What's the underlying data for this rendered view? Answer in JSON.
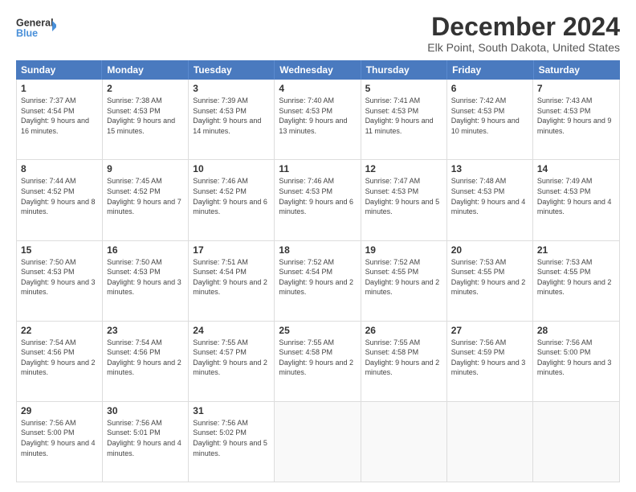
{
  "logo": {
    "line1": "General",
    "line2": "Blue"
  },
  "title": "December 2024",
  "subtitle": "Elk Point, South Dakota, United States",
  "header_days": [
    "Sunday",
    "Monday",
    "Tuesday",
    "Wednesday",
    "Thursday",
    "Friday",
    "Saturday"
  ],
  "weeks": [
    [
      {
        "day": "1",
        "sunrise": "Sunrise: 7:37 AM",
        "sunset": "Sunset: 4:54 PM",
        "daylight": "Daylight: 9 hours and 16 minutes."
      },
      {
        "day": "2",
        "sunrise": "Sunrise: 7:38 AM",
        "sunset": "Sunset: 4:53 PM",
        "daylight": "Daylight: 9 hours and 15 minutes."
      },
      {
        "day": "3",
        "sunrise": "Sunrise: 7:39 AM",
        "sunset": "Sunset: 4:53 PM",
        "daylight": "Daylight: 9 hours and 14 minutes."
      },
      {
        "day": "4",
        "sunrise": "Sunrise: 7:40 AM",
        "sunset": "Sunset: 4:53 PM",
        "daylight": "Daylight: 9 hours and 13 minutes."
      },
      {
        "day": "5",
        "sunrise": "Sunrise: 7:41 AM",
        "sunset": "Sunset: 4:53 PM",
        "daylight": "Daylight: 9 hours and 11 minutes."
      },
      {
        "day": "6",
        "sunrise": "Sunrise: 7:42 AM",
        "sunset": "Sunset: 4:53 PM",
        "daylight": "Daylight: 9 hours and 10 minutes."
      },
      {
        "day": "7",
        "sunrise": "Sunrise: 7:43 AM",
        "sunset": "Sunset: 4:53 PM",
        "daylight": "Daylight: 9 hours and 9 minutes."
      }
    ],
    [
      {
        "day": "8",
        "sunrise": "Sunrise: 7:44 AM",
        "sunset": "Sunset: 4:52 PM",
        "daylight": "Daylight: 9 hours and 8 minutes."
      },
      {
        "day": "9",
        "sunrise": "Sunrise: 7:45 AM",
        "sunset": "Sunset: 4:52 PM",
        "daylight": "Daylight: 9 hours and 7 minutes."
      },
      {
        "day": "10",
        "sunrise": "Sunrise: 7:46 AM",
        "sunset": "Sunset: 4:52 PM",
        "daylight": "Daylight: 9 hours and 6 minutes."
      },
      {
        "day": "11",
        "sunrise": "Sunrise: 7:46 AM",
        "sunset": "Sunset: 4:53 PM",
        "daylight": "Daylight: 9 hours and 6 minutes."
      },
      {
        "day": "12",
        "sunrise": "Sunrise: 7:47 AM",
        "sunset": "Sunset: 4:53 PM",
        "daylight": "Daylight: 9 hours and 5 minutes."
      },
      {
        "day": "13",
        "sunrise": "Sunrise: 7:48 AM",
        "sunset": "Sunset: 4:53 PM",
        "daylight": "Daylight: 9 hours and 4 minutes."
      },
      {
        "day": "14",
        "sunrise": "Sunrise: 7:49 AM",
        "sunset": "Sunset: 4:53 PM",
        "daylight": "Daylight: 9 hours and 4 minutes."
      }
    ],
    [
      {
        "day": "15",
        "sunrise": "Sunrise: 7:50 AM",
        "sunset": "Sunset: 4:53 PM",
        "daylight": "Daylight: 9 hours and 3 minutes."
      },
      {
        "day": "16",
        "sunrise": "Sunrise: 7:50 AM",
        "sunset": "Sunset: 4:53 PM",
        "daylight": "Daylight: 9 hours and 3 minutes."
      },
      {
        "day": "17",
        "sunrise": "Sunrise: 7:51 AM",
        "sunset": "Sunset: 4:54 PM",
        "daylight": "Daylight: 9 hours and 2 minutes."
      },
      {
        "day": "18",
        "sunrise": "Sunrise: 7:52 AM",
        "sunset": "Sunset: 4:54 PM",
        "daylight": "Daylight: 9 hours and 2 minutes."
      },
      {
        "day": "19",
        "sunrise": "Sunrise: 7:52 AM",
        "sunset": "Sunset: 4:55 PM",
        "daylight": "Daylight: 9 hours and 2 minutes."
      },
      {
        "day": "20",
        "sunrise": "Sunrise: 7:53 AM",
        "sunset": "Sunset: 4:55 PM",
        "daylight": "Daylight: 9 hours and 2 minutes."
      },
      {
        "day": "21",
        "sunrise": "Sunrise: 7:53 AM",
        "sunset": "Sunset: 4:55 PM",
        "daylight": "Daylight: 9 hours and 2 minutes."
      }
    ],
    [
      {
        "day": "22",
        "sunrise": "Sunrise: 7:54 AM",
        "sunset": "Sunset: 4:56 PM",
        "daylight": "Daylight: 9 hours and 2 minutes."
      },
      {
        "day": "23",
        "sunrise": "Sunrise: 7:54 AM",
        "sunset": "Sunset: 4:56 PM",
        "daylight": "Daylight: 9 hours and 2 minutes."
      },
      {
        "day": "24",
        "sunrise": "Sunrise: 7:55 AM",
        "sunset": "Sunset: 4:57 PM",
        "daylight": "Daylight: 9 hours and 2 minutes."
      },
      {
        "day": "25",
        "sunrise": "Sunrise: 7:55 AM",
        "sunset": "Sunset: 4:58 PM",
        "daylight": "Daylight: 9 hours and 2 minutes."
      },
      {
        "day": "26",
        "sunrise": "Sunrise: 7:55 AM",
        "sunset": "Sunset: 4:58 PM",
        "daylight": "Daylight: 9 hours and 2 minutes."
      },
      {
        "day": "27",
        "sunrise": "Sunrise: 7:56 AM",
        "sunset": "Sunset: 4:59 PM",
        "daylight": "Daylight: 9 hours and 3 minutes."
      },
      {
        "day": "28",
        "sunrise": "Sunrise: 7:56 AM",
        "sunset": "Sunset: 5:00 PM",
        "daylight": "Daylight: 9 hours and 3 minutes."
      }
    ],
    [
      {
        "day": "29",
        "sunrise": "Sunrise: 7:56 AM",
        "sunset": "Sunset: 5:00 PM",
        "daylight": "Daylight: 9 hours and 4 minutes."
      },
      {
        "day": "30",
        "sunrise": "Sunrise: 7:56 AM",
        "sunset": "Sunset: 5:01 PM",
        "daylight": "Daylight: 9 hours and 4 minutes."
      },
      {
        "day": "31",
        "sunrise": "Sunrise: 7:56 AM",
        "sunset": "Sunset: 5:02 PM",
        "daylight": "Daylight: 9 hours and 5 minutes."
      },
      {
        "day": "",
        "sunrise": "",
        "sunset": "",
        "daylight": ""
      },
      {
        "day": "",
        "sunrise": "",
        "sunset": "",
        "daylight": ""
      },
      {
        "day": "",
        "sunrise": "",
        "sunset": "",
        "daylight": ""
      },
      {
        "day": "",
        "sunrise": "",
        "sunset": "",
        "daylight": ""
      }
    ]
  ]
}
